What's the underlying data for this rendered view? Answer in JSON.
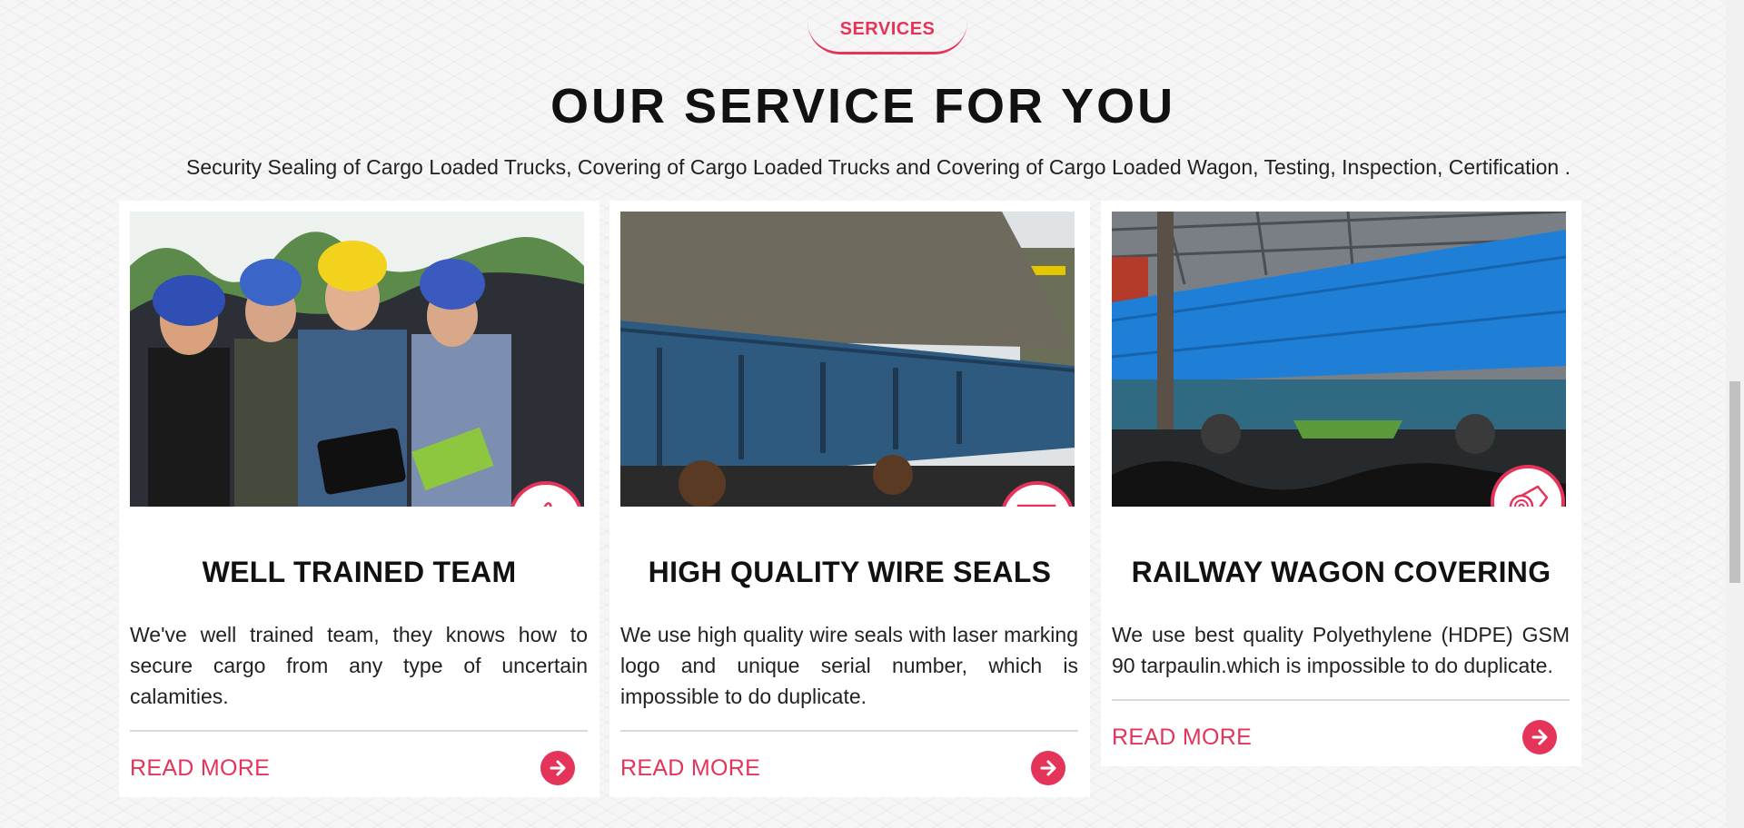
{
  "section": {
    "tag": "SERVICES",
    "heading": "OUR SERVICE FOR YOU",
    "subheading": "Security Sealing of Cargo Loaded Trucks, Covering of Cargo Loaded Trucks and Covering of Cargo Loaded Wagon, Testing, Inspection, Certification ."
  },
  "cards": [
    {
      "title": "WELL TRAINED TEAM",
      "text": "We've well trained team, they knows how to secure cargo from any type of uncertain calamities.",
      "read_more": "READ MORE",
      "icon": "thumbs-up-icon"
    },
    {
      "title": "HIGH QUALITY WIRE SEALS",
      "text": "We use high quality wire seals with laser marking logo and unique serial number, which is impossible to do duplicate.",
      "read_more": "READ MORE",
      "icon": "wire-seal-icon"
    },
    {
      "title": "RAILWAY WAGON COVERING",
      "text": "We use best quality Polyethylene (HDPE) GSM 90 tarpaulin.which is impossible to do duplicate.",
      "read_more": "READ MORE",
      "icon": "tarpaulin-roll-icon"
    }
  ],
  "colors": {
    "accent": "#e5345a",
    "heading": "#111111",
    "background": "#f6f6f6"
  }
}
